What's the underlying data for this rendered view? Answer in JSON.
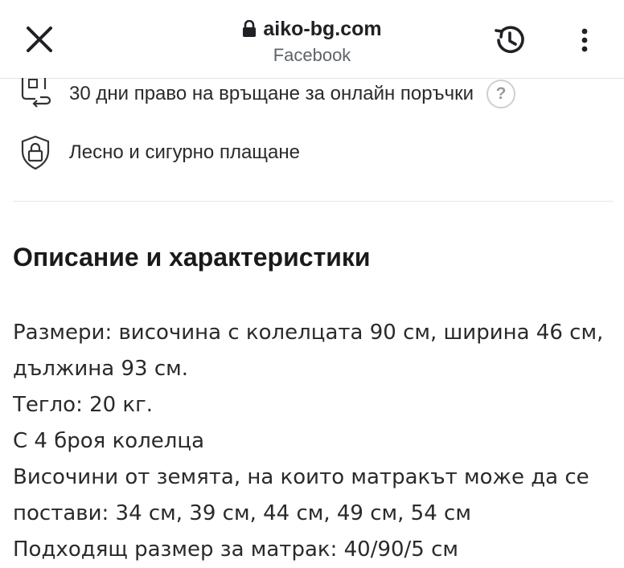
{
  "browser": {
    "domain": "aiko-bg.com",
    "source": "Facebook"
  },
  "features": [
    {
      "icon": "return-box-icon",
      "label": "30 дни право на връщане за онлайн поръчки",
      "help": "?"
    },
    {
      "icon": "secure-payment-icon",
      "label": "Лесно и сигурно плащане"
    }
  ],
  "section": {
    "title": "Описание и характеристики"
  },
  "description": {
    "lines": [
      "Размери: височина с колелцата 90 см, ширина 46 см, дължина 93 см.",
      "Тегло: 20 кг.",
      "С 4 броя колелца",
      "Височини от земята, на които матракът може да се постави: 34 см, 39 см, 44 см, 49 см, 54 см",
      "Подходящ размер за матрак: 40/90/5 см"
    ]
  }
}
